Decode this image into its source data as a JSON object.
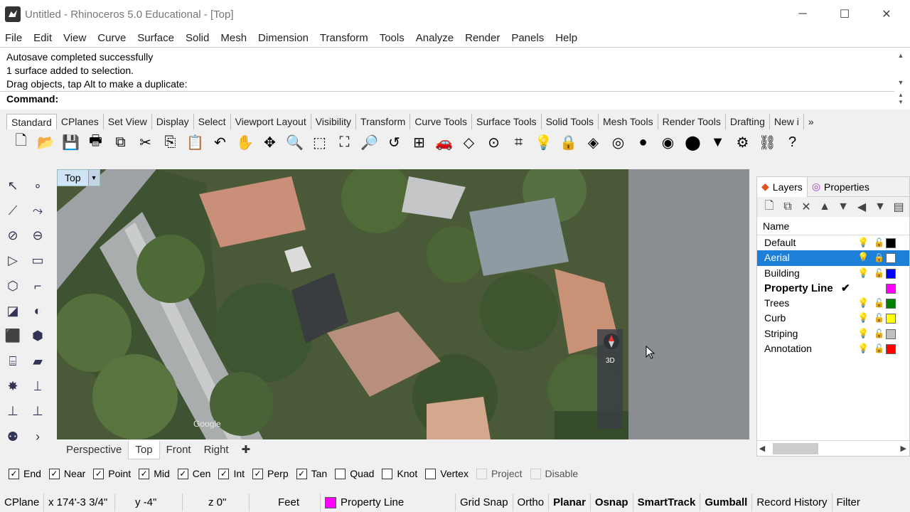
{
  "window": {
    "title": "Untitled - Rhinoceros 5.0 Educational - [Top]"
  },
  "menu": [
    "File",
    "Edit",
    "View",
    "Curve",
    "Surface",
    "Solid",
    "Mesh",
    "Dimension",
    "Transform",
    "Tools",
    "Analyze",
    "Render",
    "Panels",
    "Help"
  ],
  "command_history": [
    "Autosave completed successfully",
    "1 surface added to selection.",
    "Drag objects, tap Alt to make a duplicate:"
  ],
  "command_prompt": "Command:",
  "toolbar_tabs": [
    "Standard",
    "CPlanes",
    "Set View",
    "Display",
    "Select",
    "Viewport Layout",
    "Visibility",
    "Transform",
    "Curve Tools",
    "Surface Tools",
    "Solid Tools",
    "Mesh Tools",
    "Render Tools",
    "Drafting",
    "New i"
  ],
  "toolbar_overflow": "»",
  "standard_tools": [
    {
      "icon": "new-file-icon",
      "glyph": "🗋"
    },
    {
      "icon": "open-folder-icon",
      "glyph": "📂"
    },
    {
      "icon": "save-icon",
      "glyph": "💾"
    },
    {
      "icon": "print-icon",
      "glyph": "🖶"
    },
    {
      "icon": "import-icon",
      "glyph": "⧉"
    },
    {
      "icon": "cut-icon",
      "glyph": "✂"
    },
    {
      "icon": "copy-icon",
      "glyph": "⎘"
    },
    {
      "icon": "paste-icon",
      "glyph": "📋"
    },
    {
      "icon": "undo-icon",
      "glyph": "↶"
    },
    {
      "icon": "pan-hand-icon",
      "glyph": "✋"
    },
    {
      "icon": "rotate-view-icon",
      "glyph": "✥"
    },
    {
      "icon": "zoom-icon",
      "glyph": "🔍"
    },
    {
      "icon": "zoom-window-icon",
      "glyph": "⬚"
    },
    {
      "icon": "zoom-extents-icon",
      "glyph": "⛶"
    },
    {
      "icon": "zoom-selected-icon",
      "glyph": "🔎"
    },
    {
      "icon": "undo-view-icon",
      "glyph": "↺"
    },
    {
      "icon": "four-viewports-icon",
      "glyph": "⊞"
    },
    {
      "icon": "car-icon",
      "glyph": "🚗"
    },
    {
      "icon": "construction-plane-icon",
      "glyph": "◇"
    },
    {
      "icon": "snap-icon",
      "glyph": "⊙"
    },
    {
      "icon": "select-points-icon",
      "glyph": "⌗"
    },
    {
      "icon": "light-bulb-icon",
      "glyph": "💡"
    },
    {
      "icon": "lock-icon",
      "glyph": "🔒"
    },
    {
      "icon": "layer-icon",
      "glyph": "◈"
    },
    {
      "icon": "color-wheel-icon",
      "glyph": "◎"
    },
    {
      "icon": "shaded-sphere-icon",
      "glyph": "●"
    },
    {
      "icon": "rendered-sphere-icon",
      "glyph": "◉"
    },
    {
      "icon": "blue-sphere-icon",
      "glyph": "⬤"
    },
    {
      "icon": "spotlight-icon",
      "glyph": "▼"
    },
    {
      "icon": "options-gear-icon",
      "glyph": "⚙"
    },
    {
      "icon": "grasshopper-icon",
      "glyph": "⛓"
    },
    {
      "icon": "help-icon",
      "glyph": "?"
    }
  ],
  "left_tools": [
    {
      "icon": "select-arrow-icon",
      "glyph": "↖"
    },
    {
      "icon": "point-icon",
      "glyph": "∘"
    },
    {
      "icon": "polyline-icon",
      "glyph": "⟋"
    },
    {
      "icon": "curve-icon",
      "glyph": "⤳"
    },
    {
      "icon": "circle-icon",
      "glyph": "⊘"
    },
    {
      "icon": "ellipse-icon",
      "glyph": "⊖"
    },
    {
      "icon": "polygon-icon",
      "glyph": "▷"
    },
    {
      "icon": "rectangle-icon",
      "glyph": "▭"
    },
    {
      "icon": "arc-icon",
      "glyph": "⬡"
    },
    {
      "icon": "fillet-icon",
      "glyph": "⌐"
    },
    {
      "icon": "surface-icon",
      "glyph": "◪"
    },
    {
      "icon": "revolve-icon",
      "glyph": "◐"
    },
    {
      "icon": "box-icon",
      "glyph": "⬛"
    },
    {
      "icon": "solid-sphere-icon",
      "glyph": "⬢"
    },
    {
      "icon": "cylinder-icon",
      "glyph": "⌸"
    },
    {
      "icon": "mesh-icon",
      "glyph": "▰"
    },
    {
      "icon": "explode-icon",
      "glyph": "✸"
    },
    {
      "icon": "trim-icon",
      "glyph": "⟘"
    },
    {
      "icon": "move-icon",
      "glyph": "⊥"
    },
    {
      "icon": "array-icon",
      "glyph": "⊥"
    },
    {
      "icon": "boolean-icon",
      "glyph": "⚉"
    },
    {
      "icon": "more-tools-icon",
      "glyph": "›"
    }
  ],
  "viewport": {
    "label": "Top",
    "dropdown": "▼",
    "google_watermark": "Google",
    "nav_3d": "3D"
  },
  "viewport_tabs": [
    "Perspective",
    "Top",
    "Front",
    "Right"
  ],
  "viewport_add": "✚",
  "panel_tabs": [
    {
      "label": "Layers",
      "icon": "layers-icon"
    },
    {
      "label": "Properties",
      "icon": "properties-icon"
    }
  ],
  "layer_tools": [
    "new-layer-icon",
    "new-sublayer-icon",
    "delete-layer-icon",
    "move-up-icon",
    "move-down-icon",
    "move-left-icon",
    "filter-icon",
    "layer-settings-icon"
  ],
  "layer_tool_glyphs": [
    "🗋",
    "⧉",
    "✕",
    "▲",
    "▼",
    "◀",
    "▼",
    "▤"
  ],
  "layers_header": "Name",
  "layers": [
    {
      "name": "Default",
      "color": "#000000",
      "state": "normal"
    },
    {
      "name": "Aerial",
      "color": "#ffffff",
      "state": "selected"
    },
    {
      "name": "Building",
      "color": "#0000ff",
      "state": "normal"
    },
    {
      "name": "Property Line",
      "color": "#ff00ff",
      "state": "current",
      "check": "✔"
    },
    {
      "name": "Trees",
      "color": "#008000",
      "state": "normal"
    },
    {
      "name": "Curb",
      "color": "#ffff00",
      "state": "normal"
    },
    {
      "name": "Striping",
      "color": "#c0c0c0",
      "state": "normal"
    },
    {
      "name": "Annotation",
      "color": "#ff0000",
      "state": "normal"
    }
  ],
  "osnaps": [
    {
      "label": "End",
      "checked": true,
      "enabled": true
    },
    {
      "label": "Near",
      "checked": true,
      "enabled": true
    },
    {
      "label": "Point",
      "checked": true,
      "enabled": true
    },
    {
      "label": "Mid",
      "checked": true,
      "enabled": true
    },
    {
      "label": "Cen",
      "checked": true,
      "enabled": true
    },
    {
      "label": "Int",
      "checked": true,
      "enabled": true
    },
    {
      "label": "Perp",
      "checked": true,
      "enabled": true
    },
    {
      "label": "Tan",
      "checked": true,
      "enabled": true
    },
    {
      "label": "Quad",
      "checked": false,
      "enabled": true
    },
    {
      "label": "Knot",
      "checked": false,
      "enabled": true
    },
    {
      "label": "Vertex",
      "checked": false,
      "enabled": true
    },
    {
      "label": "Project",
      "checked": false,
      "enabled": false
    },
    {
      "label": "Disable",
      "checked": false,
      "enabled": false
    }
  ],
  "status": {
    "cplane": "CPlane",
    "x": "x 174'-3 3/4\"",
    "y": "y -4\"",
    "z": "z 0\"",
    "units": "Feet",
    "layer": "Property Line",
    "layer_color": "#ff00ff",
    "grid_snap": "Grid Snap",
    "ortho": "Ortho",
    "planar": "Planar",
    "osnap": "Osnap",
    "smarttrack": "SmartTrack",
    "gumball": "Gumball",
    "record_history": "Record History",
    "filter": "Filter"
  }
}
